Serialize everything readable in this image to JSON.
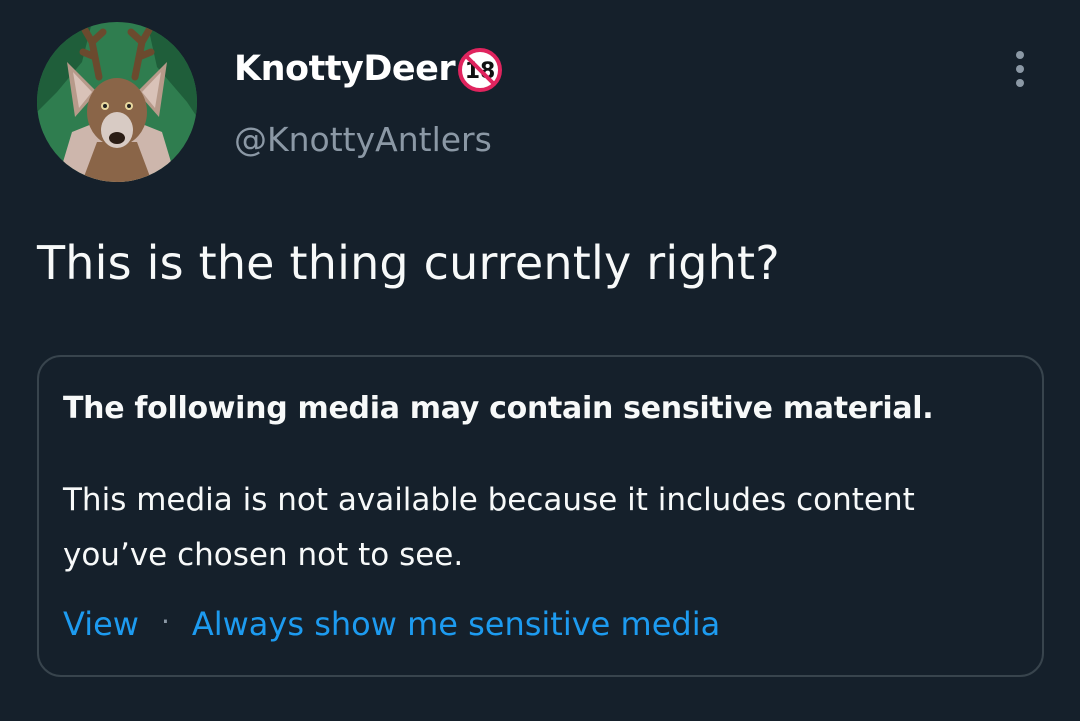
{
  "tweet": {
    "author": {
      "display_name": "KnottyDeer",
      "handle": "@KnottyAntlers",
      "badge": "18",
      "badge_icon": "age-restricted-icon",
      "avatar_icon": "deer-avatar"
    },
    "menu_icon": "more-vertical-icon",
    "text": "This is the thing currently right?",
    "sensitive_media": {
      "heading": "The following media may contain sensitive material.",
      "body": "This media is not available because it includes content you’ve chosen not to see.",
      "view_label": "View",
      "separator": "·",
      "always_show_label": "Always show me sensitive media"
    }
  },
  "colors": {
    "background": "#15202b",
    "text_primary": "#f7f9f9",
    "text_secondary": "#8b98a5",
    "link": "#1d9bf0",
    "border": "#38444d",
    "badge_red": "#e0245e"
  }
}
